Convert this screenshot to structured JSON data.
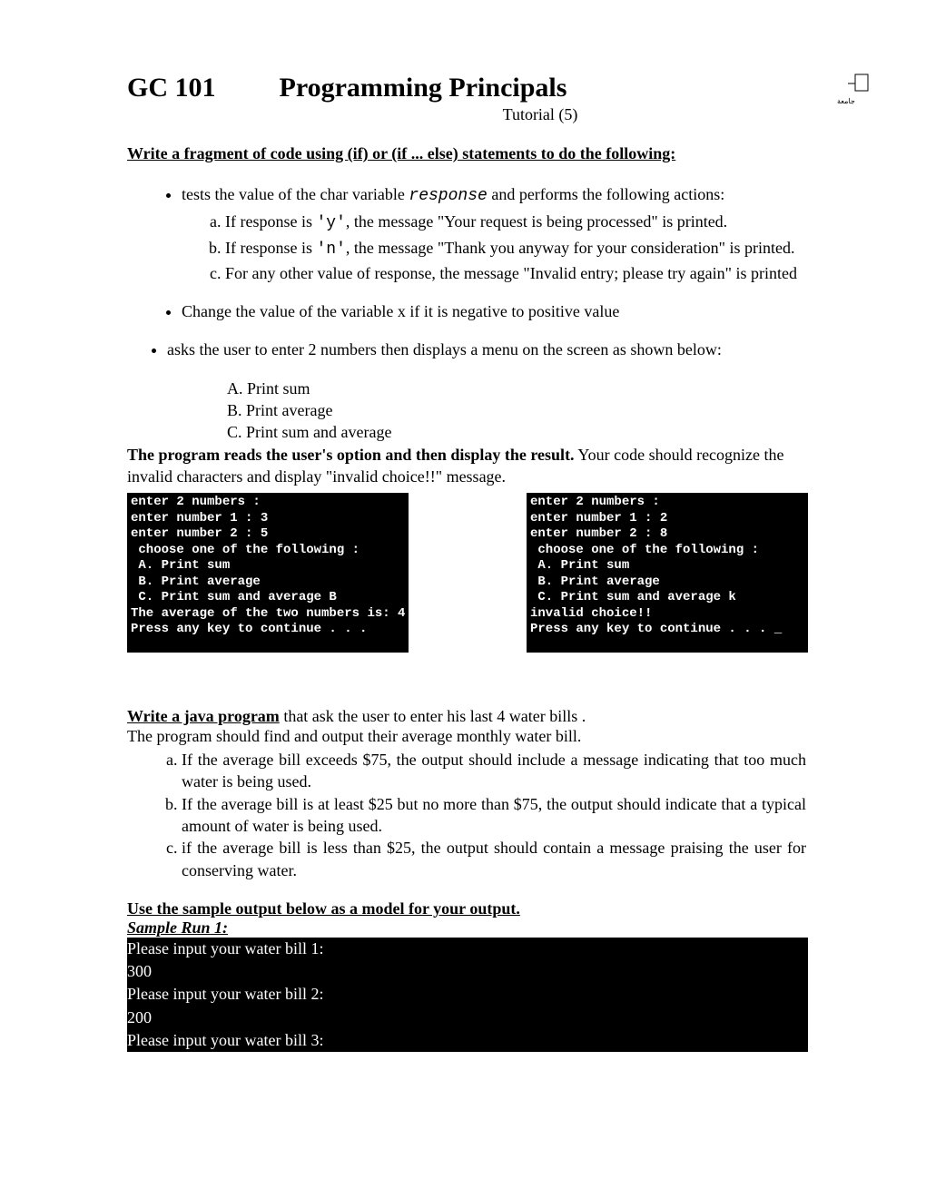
{
  "header": {
    "course_code": "GC 101",
    "course_title": "Programming Principals",
    "tutorial_label": "Tutorial (5)"
  },
  "section1": {
    "heading": "Write a fragment of code using (if) or (if  ... else) statements to do the following:",
    "bullet1_pre": "tests the value of the char variable ",
    "bullet1_var": "response",
    "bullet1_post": " and performs the following actions:",
    "b1_a_pre": "If response is ",
    "b1_a_code": "'y'",
    "b1_a_post": ", the message \"Your request is being processed\" is printed.",
    "b1_b_pre": "If response is ",
    "b1_b_code": "'n'",
    "b1_b_post": ", the message \"Thank you anyway for your consideration\" is printed.",
    "b1_c": "For any other value of response, the message \"Invalid entry; please try again\" is printed",
    "bullet2": "Change  the value of the variable x if it is negative to positive value",
    "bullet3": "asks the user to enter 2 numbers then displays a menu on the screen as shown below:",
    "menu_a": "A. Print sum",
    "menu_b": "B. Print average",
    "menu_c": "C. Print sum and average",
    "after1_strong": "The program reads the user's option and then display the result.",
    "after1_rest": " Your code should recognize the invalid characters and display \"invalid choice!!\" message."
  },
  "consoles": {
    "left": "enter 2 numbers :\nenter number 1 : 3\nenter number 2 : 5\n choose one of the following :\n A. Print sum\n B. Print average\n C. Print sum and average B\nThe average of the two numbers is: 4\nPress any key to continue . . .",
    "right": "enter 2 numbers :\nenter number 1 : 2\nenter number 2 : 8\n choose one of the following :\n A. Print sum\n B. Print average\n C. Print sum and average k\ninvalid choice!!\nPress any key to continue . . . _"
  },
  "section2": {
    "heading_u": "Write a java program",
    "heading_rest": " that ask the user to enter his last 4 water bills .",
    "line2": "The program should find and output their average monthly water bill.",
    "item_a": "If the average bill exceeds $75, the output should include a message indicating that too much water is being used.",
    "item_b": "If the average bill is at least $25 but no more than $75, the output should indicate that a typical amount of water is being used.",
    "item_c": "if the average bill is less than $25, the output should contain a message praising the user for conserving water."
  },
  "sample": {
    "heading": "Use the sample output below as a model for your output.",
    "run_label": "Sample Run 1:",
    "rows": [
      "Please input your water bill 1:",
      "300",
      "Please input your water bill 2:",
      "200",
      "Please input your water bill 3:"
    ]
  }
}
